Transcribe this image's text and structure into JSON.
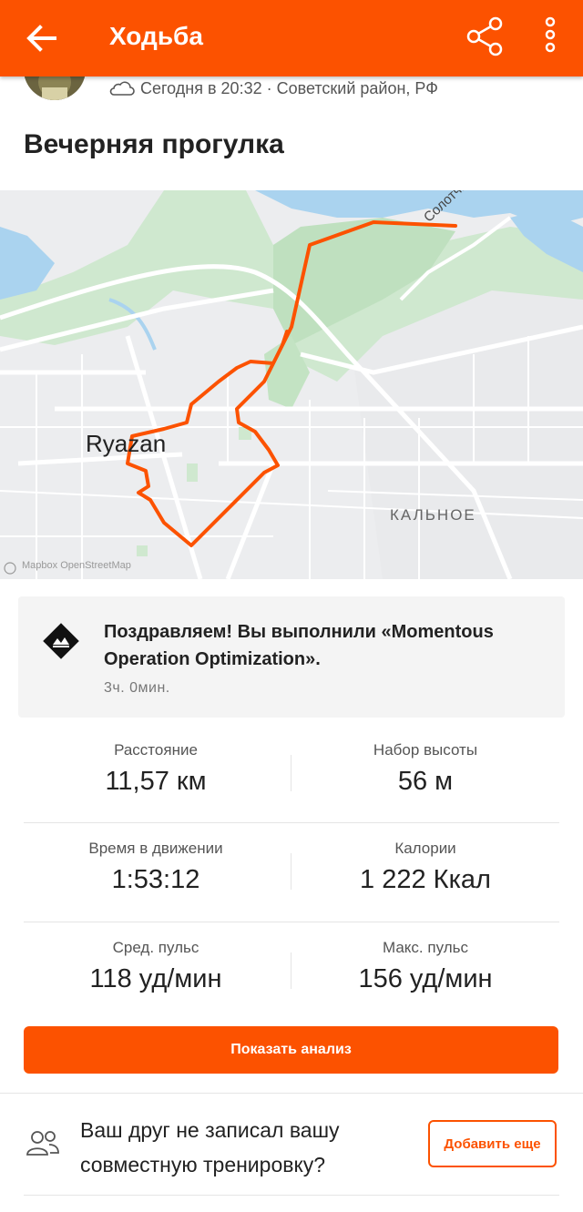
{
  "header": {
    "title": "Ходьба",
    "back_icon": "arrow-left-icon",
    "share_icon": "share-icon",
    "more_icon": "more-vertical-icon"
  },
  "activity": {
    "meta": "Сегодня в 20:32 · Советский район, РФ",
    "weather_icon": "cloud-icon",
    "name": "Вечерняя прогулка"
  },
  "map": {
    "city_label": "Ryazan",
    "district_label": "КАЛЬНОЕ",
    "road_label": "Солотчинское шо",
    "attribution": "Mapbox   OpenStreetMap",
    "route_color": "#fc5200"
  },
  "achievement": {
    "text": "Поздравляем! Вы выполнили «Momentous Operation Optimization».",
    "time": "3ч. 0мин.",
    "icon": "challenge-badge-icon"
  },
  "stats": [
    {
      "label": "Расстояние",
      "value": "11,57 км"
    },
    {
      "label": "Набор высоты",
      "value": "56 м"
    },
    {
      "label": "Время в движении",
      "value": "1:53:12"
    },
    {
      "label": "Калории",
      "value": "1 222 Ккал"
    },
    {
      "label": "Сред. пульс",
      "value": "118 уд/мин"
    },
    {
      "label": "Макс. пульс",
      "value": "156 уд/мин"
    }
  ],
  "analysis_button": "Показать анализ",
  "friend": {
    "icon": "people-icon",
    "text": "Ваш друг не записал вашу совместную тренировку?",
    "add_button": "Добавить еще"
  },
  "colors": {
    "brand": "#fc5200"
  }
}
